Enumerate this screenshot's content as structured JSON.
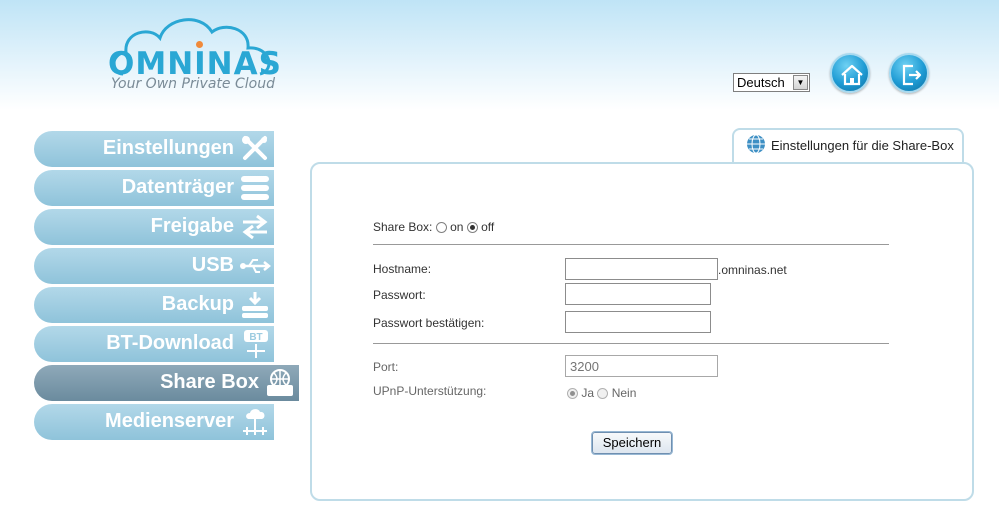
{
  "brand": {
    "name": "OMNINAS",
    "tagline": "Your Own Private Cloud"
  },
  "header": {
    "language": {
      "selected": "Deutsch",
      "icon": "dropdown-arrow-icon"
    },
    "home_icon": "home-icon",
    "logout_icon": "logout-icon"
  },
  "nav": {
    "items": [
      {
        "label": "Einstellungen",
        "icon": "tools-icon",
        "active": false
      },
      {
        "label": "Datenträger",
        "icon": "disks-icon",
        "active": false
      },
      {
        "label": "Freigabe",
        "icon": "share-arrows-icon",
        "active": false
      },
      {
        "label": "USB",
        "icon": "usb-icon",
        "active": false
      },
      {
        "label": "Backup",
        "icon": "backup-icon",
        "active": false
      },
      {
        "label": "BT-Download",
        "icon": "bt-download-icon",
        "active": false
      },
      {
        "label": "Share Box",
        "icon": "share-box-icon",
        "active": true
      },
      {
        "label": "Medienserver",
        "icon": "media-server-icon",
        "active": false
      }
    ]
  },
  "tab": {
    "label": "Einstellungen für die Share-Box",
    "icon": "globe-icon"
  },
  "form": {
    "share_box": {
      "label": "Share Box:",
      "on_label": "on",
      "off_label": "off",
      "selected": "off"
    },
    "hostname": {
      "label": "Hostname:",
      "value": "",
      "suffix": ".omninas.net"
    },
    "password": {
      "label": "Passwort:",
      "value": ""
    },
    "password_confirm": {
      "label": "Passwort bestätigen:",
      "value": ""
    },
    "port": {
      "label": "Port:",
      "placeholder": "3200"
    },
    "upnp": {
      "label": "UPnP-Unterstützung:",
      "yes_label": "Ja",
      "no_label": "Nein",
      "selected": "Ja"
    },
    "save_label": "Speichern"
  },
  "colors": {
    "accent": "#2aa7d4",
    "nav_item": "#9ccbe0",
    "nav_active": "#7b98aa",
    "panel_border": "#bfdce8"
  }
}
